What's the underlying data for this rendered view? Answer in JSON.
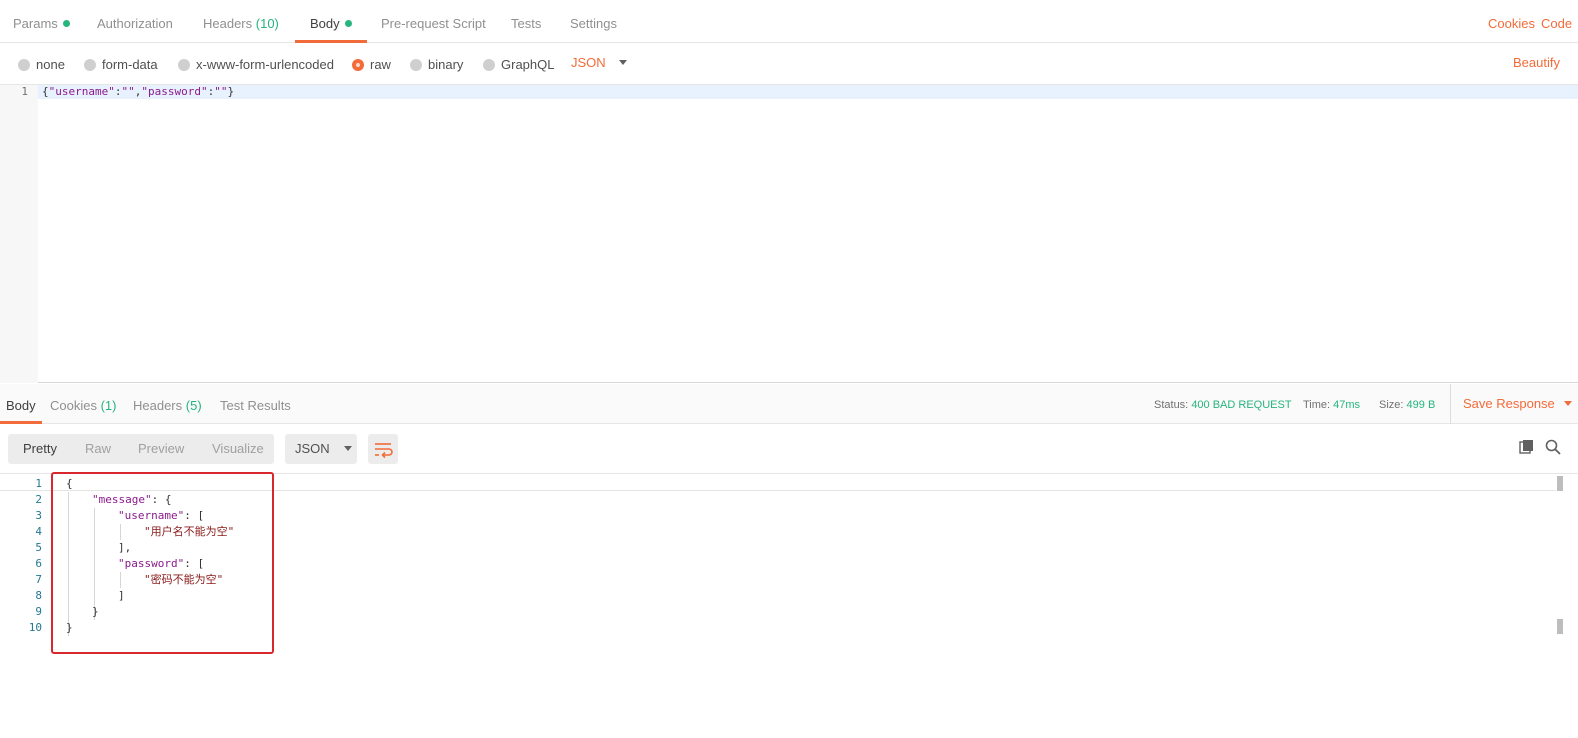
{
  "request_tabs": {
    "params": "Params",
    "authorization": "Authorization",
    "headers": "Headers",
    "headers_count": "(10)",
    "body": "Body",
    "pre_request": "Pre-request Script",
    "tests": "Tests",
    "settings": "Settings"
  },
  "links": {
    "cookies": "Cookies",
    "code": "Code",
    "beautify": "Beautify"
  },
  "body_types": {
    "none": "none",
    "form_data": "form-data",
    "urlencoded": "x-www-form-urlencoded",
    "raw": "raw",
    "binary": "binary",
    "graphql": "GraphQL",
    "selected": "raw",
    "format": "JSON"
  },
  "request_body": {
    "line_number": "1",
    "p1": "{",
    "k1": "\"username\"",
    "p2": ":",
    "v1": "\"\"",
    "p3": ",",
    "k2": "\"password\"",
    "p4": ":",
    "v2": "\"\"",
    "p5": "}"
  },
  "response_tabs": {
    "body": "Body",
    "cookies": "Cookies",
    "cookies_count": "(1)",
    "headers": "Headers",
    "headers_count": "(5)",
    "test_results": "Test Results"
  },
  "status": {
    "status_label": "Status:",
    "status_value": "400 BAD REQUEST",
    "time_label": "Time:",
    "time_value": "47ms",
    "size_label": "Size:",
    "size_value": "499 B",
    "save_response": "Save Response"
  },
  "view_modes": {
    "pretty": "Pretty",
    "raw": "Raw",
    "preview": "Preview",
    "visualize": "Visualize",
    "format": "JSON"
  },
  "response_body": {
    "line_numbers": [
      "1",
      "2",
      "3",
      "4",
      "5",
      "6",
      "7",
      "8",
      "9",
      "10"
    ],
    "l1": "{",
    "l2_key": "\"message\"",
    "l2_rest": ": {",
    "l3_key": "\"username\"",
    "l3_rest": ": [",
    "l4_val": "\"用户名不能为空\"",
    "l5": "],",
    "l6_key": "\"password\"",
    "l6_rest": ": [",
    "l7_val": "\"密码不能为空\"",
    "l8": "]",
    "l9": "}",
    "l10": "}"
  },
  "icons": {
    "copy": "copy-icon",
    "search": "search-icon",
    "wrap": "wrap-lines-icon"
  },
  "colors": {
    "accent": "#f26b3a",
    "success": "#26b47f",
    "highlight_box": "#d9272e"
  }
}
